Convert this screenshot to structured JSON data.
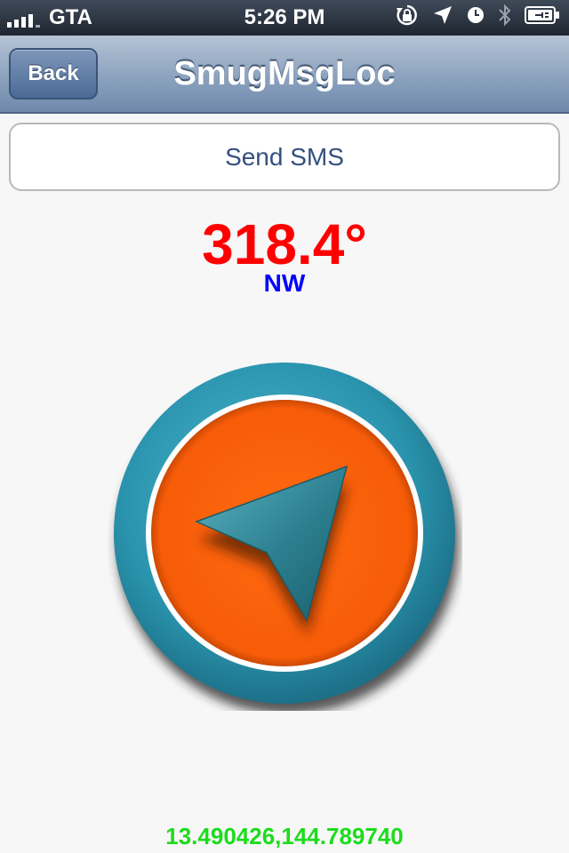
{
  "status_bar": {
    "carrier": "GTA",
    "time": "5:26 PM",
    "icons": [
      "signal-icon",
      "orientation-lock-icon",
      "location-icon",
      "alarm-icon",
      "bluetooth-icon",
      "battery-charging-icon"
    ]
  },
  "nav": {
    "back_label": "Back",
    "title": "SmugMsgLoc"
  },
  "send_button": {
    "label": "Send SMS"
  },
  "heading": {
    "degrees": "318.4°",
    "direction": "NW"
  },
  "compass": {
    "icon": "compass-arrow-icon",
    "colors": {
      "ring": "#2a94ae",
      "face": "#fb5f0b",
      "arrow": "#2c7f8f"
    }
  },
  "location": {
    "coordinates": "13.490426,144.789740"
  },
  "colors": {
    "heading": "#ff0000",
    "direction": "#0000ff",
    "coordinates": "#1cdc1c",
    "button_text": "#33507f"
  }
}
